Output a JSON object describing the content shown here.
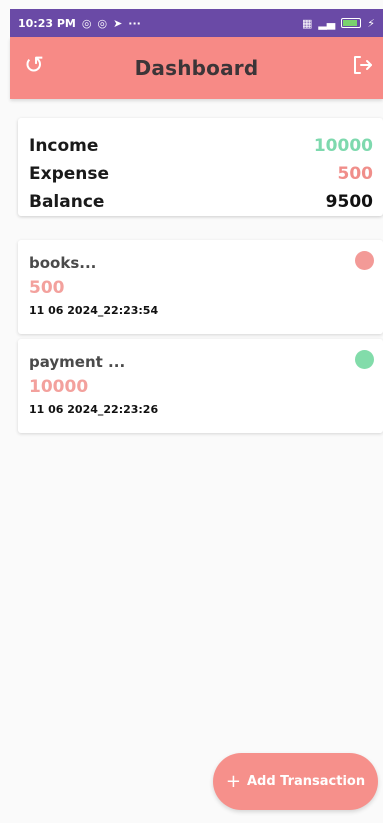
{
  "status_bar": {
    "time": "10:23 PM",
    "more": "···"
  },
  "header": {
    "title": "Dashboard"
  },
  "summary": {
    "income_label": "Income",
    "income_value": "10000",
    "expense_label": "Expense",
    "expense_value": "500",
    "balance_label": "Balance",
    "balance_value": "9500"
  },
  "transactions": [
    {
      "name": "books...",
      "amount": "500",
      "date": "11 06 2024_22:23:54",
      "type_color": "#f39a97"
    },
    {
      "name": "payment ...",
      "amount": "10000",
      "date": "11 06 2024_22:23:26",
      "type_color": "#82dcaa"
    }
  ],
  "fab": {
    "label": "Add Transaction"
  },
  "colors": {
    "accent": "#f78a86",
    "income": "#7ed9ae",
    "expense": "#f08e8a",
    "statusbar": "#6a4aa6"
  }
}
